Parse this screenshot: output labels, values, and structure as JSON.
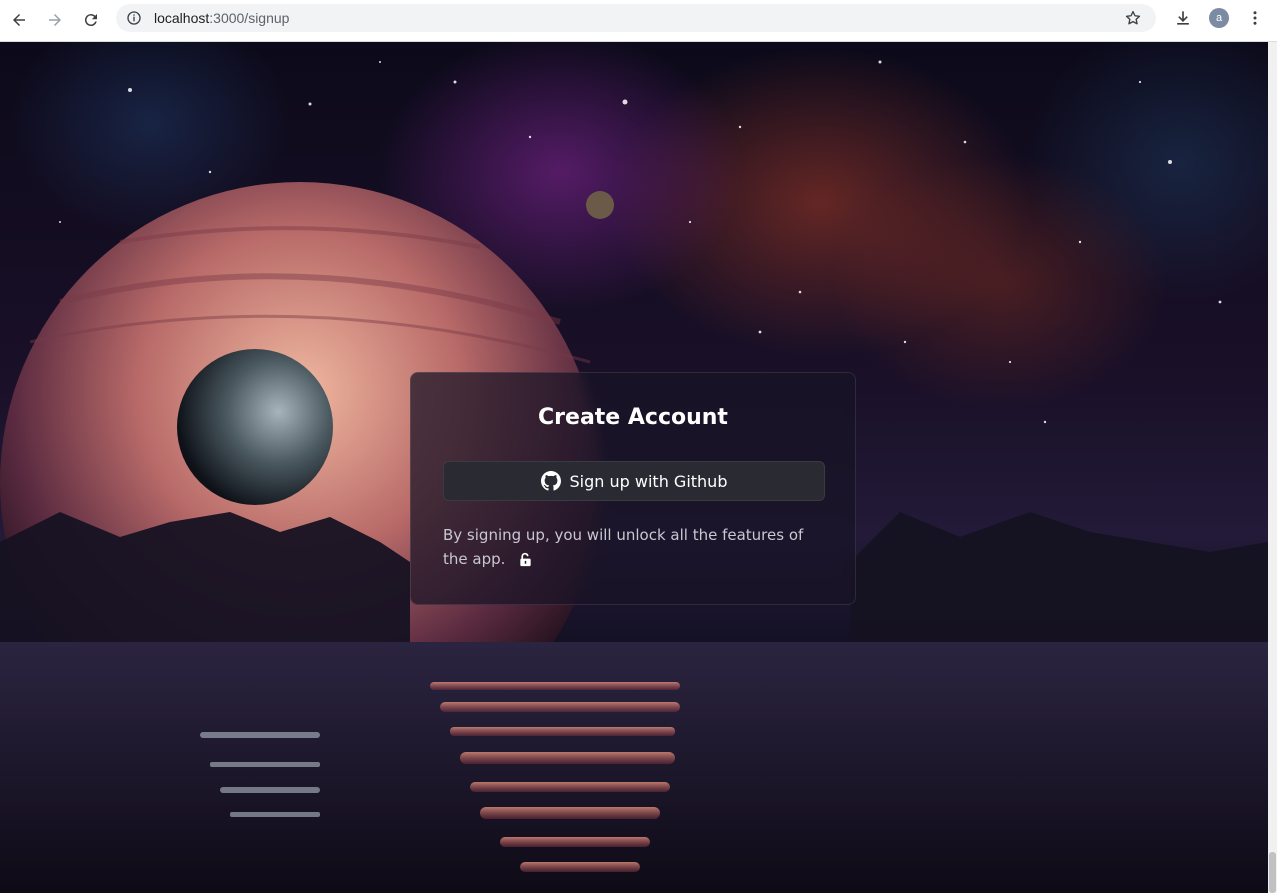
{
  "browser": {
    "url_host": "localhost",
    "url_path": ":3000/signup",
    "profile_initial": "a"
  },
  "icons": [
    "back-arrow-icon",
    "forward-arrow-icon",
    "reload-icon",
    "site-info-icon",
    "bookmark-star-icon",
    "download-icon",
    "kebab-menu-icon",
    "github-icon",
    "unlock-icon"
  ],
  "signup": {
    "title": "Create Account",
    "github_button_label": "Sign up with Github",
    "note": "By signing up, you will unlock all the features of the app."
  },
  "colors": {
    "card_bg": "#181426",
    "button_bg": "#2a2a33",
    "text": "#ffffff"
  }
}
